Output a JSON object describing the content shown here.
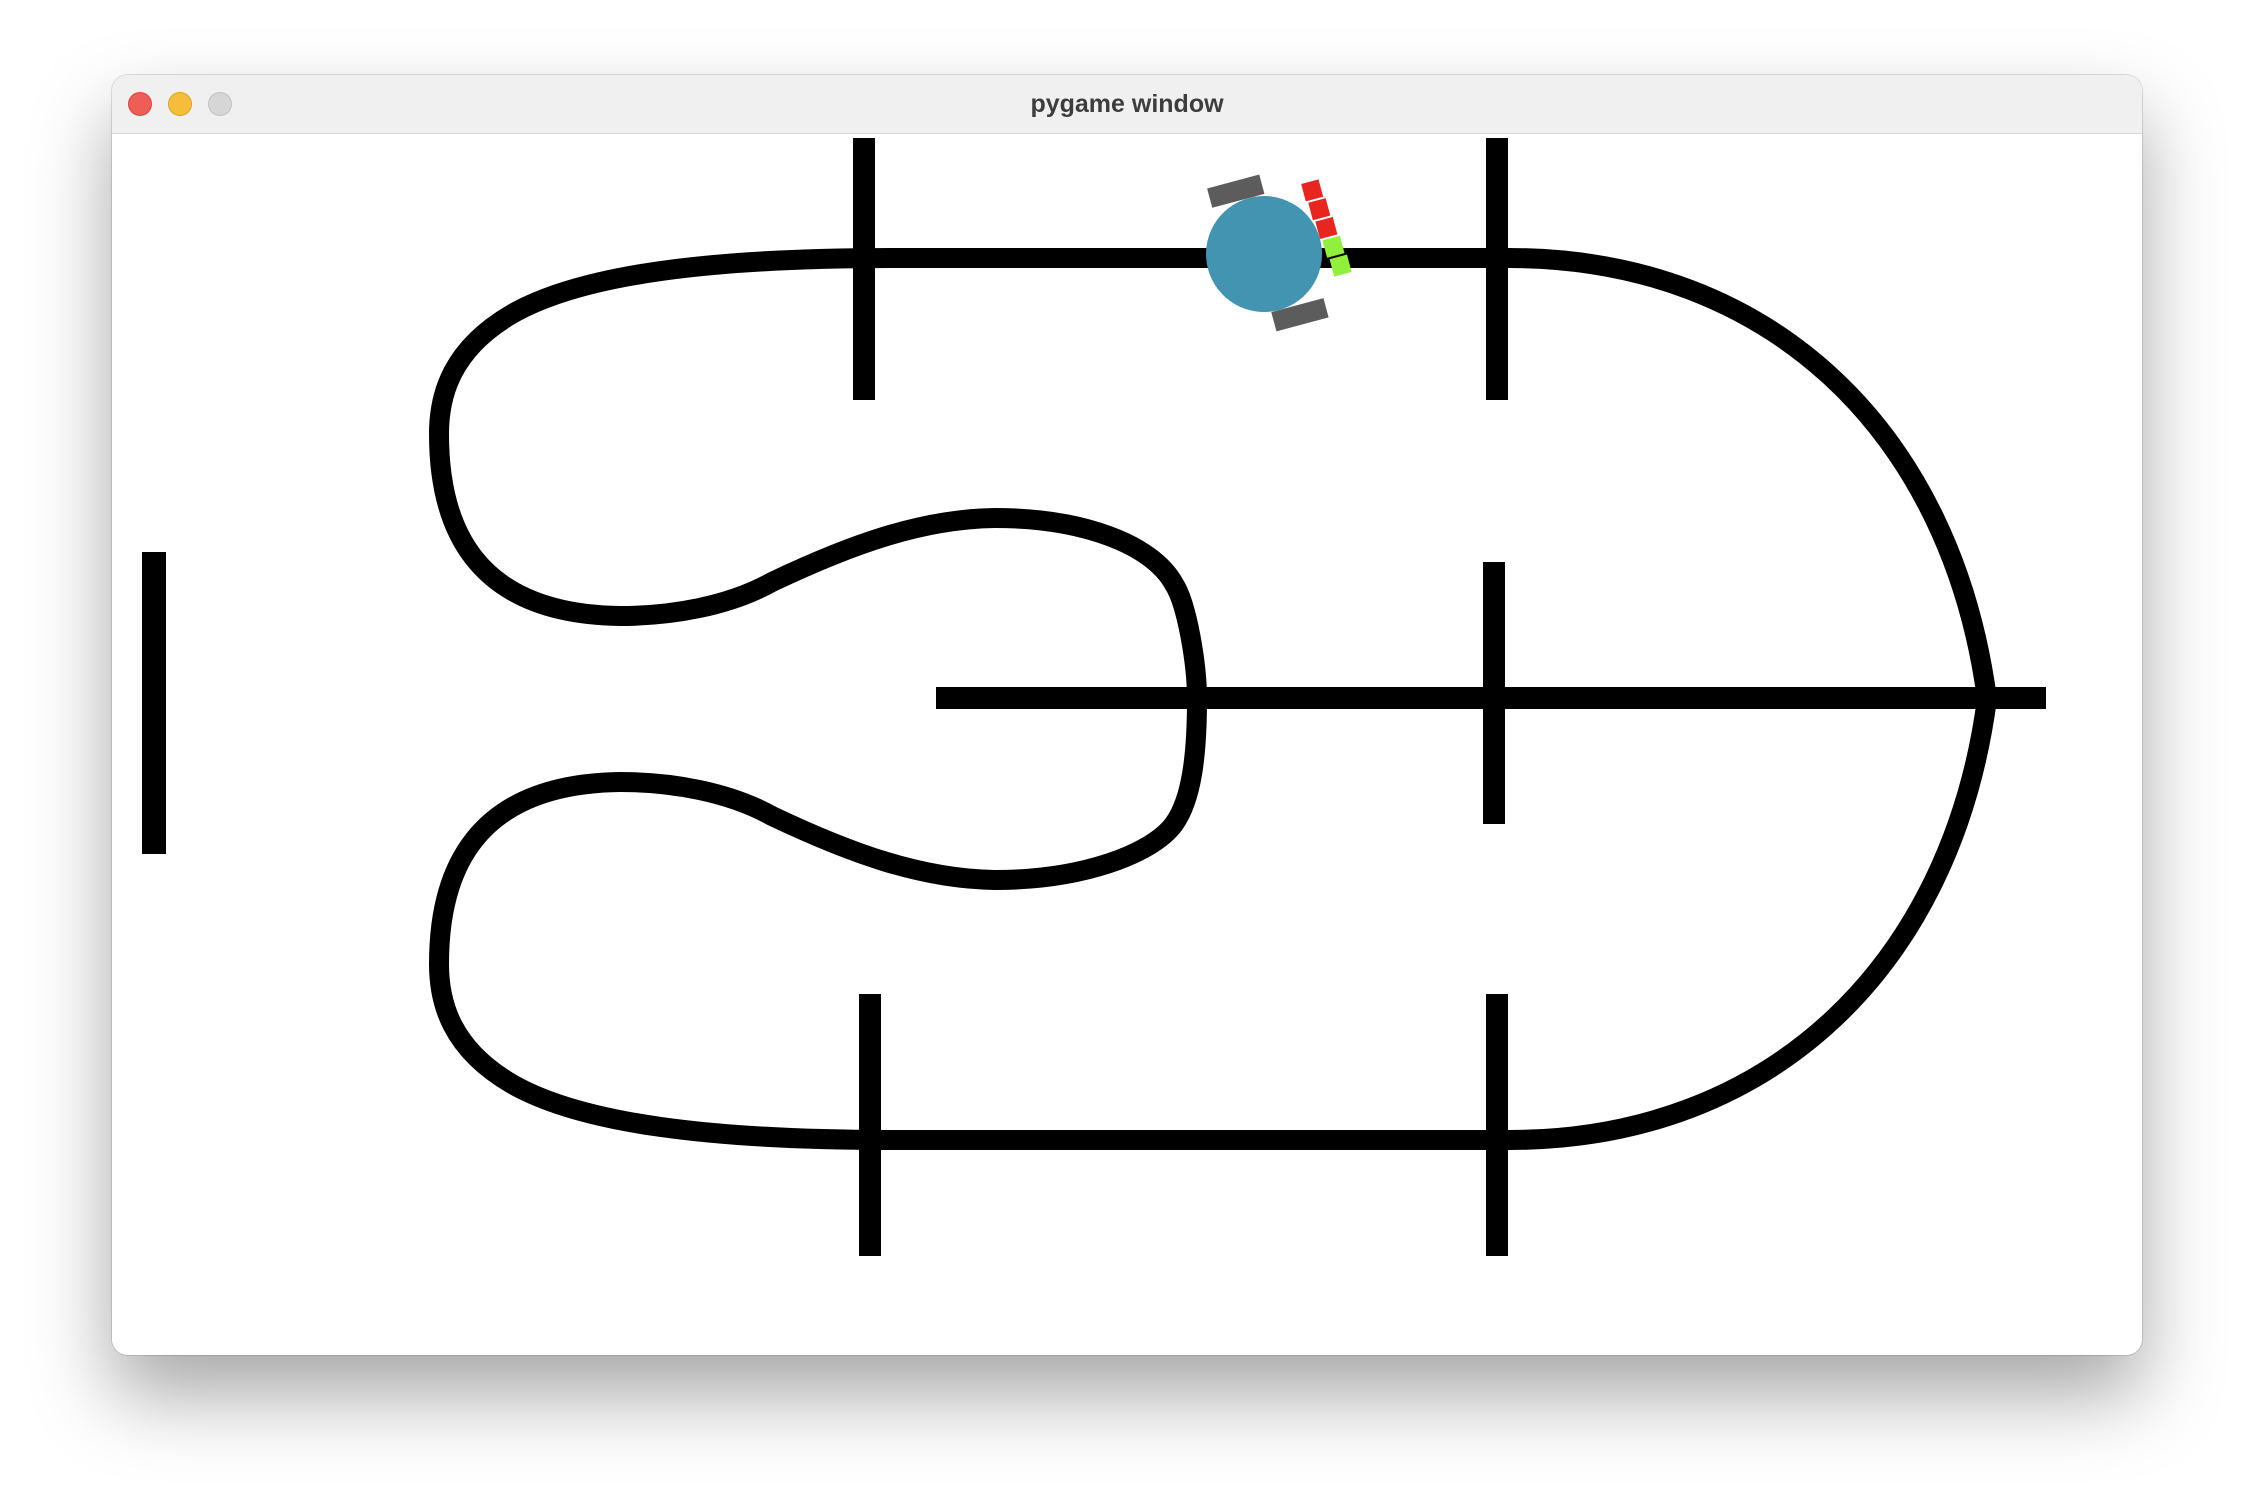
{
  "window": {
    "title": "pygame window",
    "controls": {
      "close_icon": "close-icon",
      "minimize_icon": "minimize-icon",
      "zoom_icon": "zoom-icon"
    }
  },
  "scene": {
    "track_color": "#000000",
    "background_color": "#ffffff",
    "robot": {
      "body_color": "#4394b0",
      "wheel_color": "#5c5c5c",
      "sensors_off_color": "#e8261f",
      "sensors_on_color": "#90f03c",
      "sensor_states": [
        "off",
        "off",
        "off",
        "on",
        "on"
      ]
    }
  }
}
